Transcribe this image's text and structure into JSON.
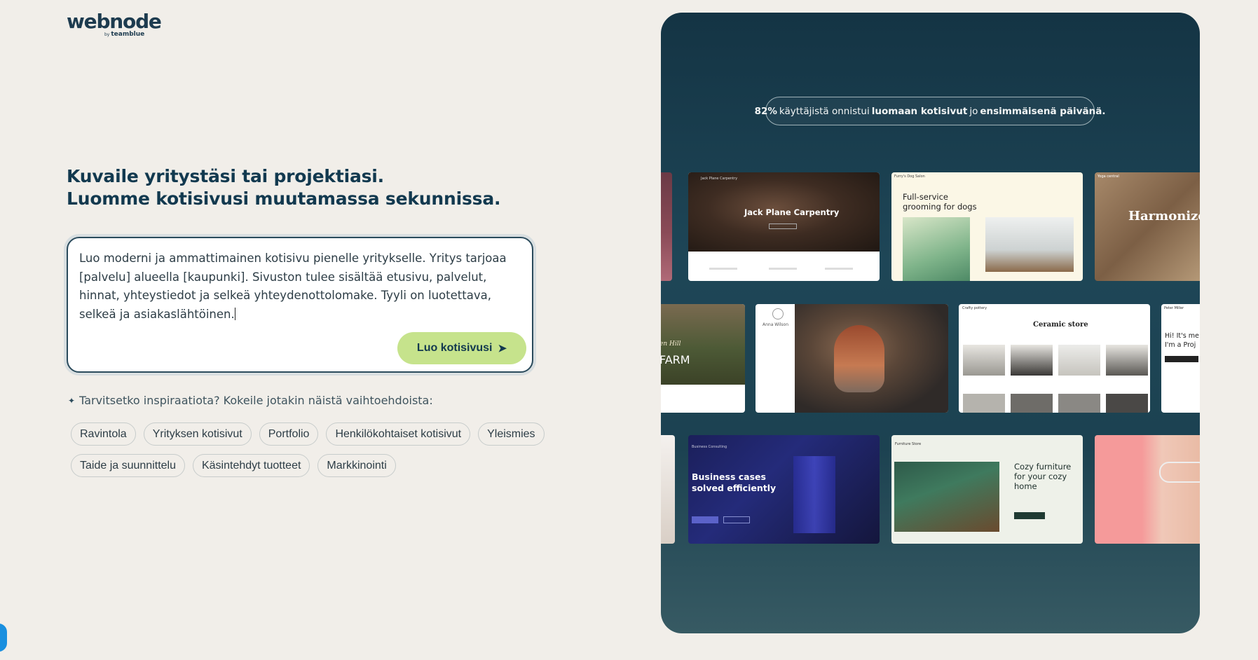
{
  "logo": {
    "word": "webnode",
    "by": "by",
    "brand": "teamblue"
  },
  "headline": {
    "line1": "Kuvaile yritystäsi tai projektiasi.",
    "line2": "Luomme kotisivusi muutamassa sekunnissa."
  },
  "prompt": {
    "text": "Luo moderni ja ammattimainen kotisivu pienelle yritykselle. Yritys tarjoaa [palvelu] alueella [kaupunki]. Sivuston tulee sisältää etusivu, palvelut, hinnat, yhteystiedot ja selkeä yhteydenottolomake. Tyyli on luotettava, selkeä ja asiakaslähtöinen.",
    "button": "Luo kotisivusi"
  },
  "inspiration": {
    "label": "Tarvitsetko inspiraatiota? Kokeile jotakin näistä vaihtoehdoista:",
    "chips_row1": [
      "Ravintola",
      "Yrityksen kotisivut",
      "Portfolio",
      "Henkilökohtaiset kotisivut",
      "Yleismies"
    ],
    "chips_row2": [
      "Taide ja suunnittelu",
      "Käsintehdyt tuotteet",
      "Markkinointi"
    ]
  },
  "panel": {
    "stat_percent": "82%",
    "stat_text1": "käyttäjistä onnistui",
    "stat_bold1": "luomaan kotisivut",
    "stat_text2": "jo",
    "stat_bold2": "ensimmäisenä päivänä.",
    "templates": {
      "carpentry": {
        "title": "Jack Plane Carpentry",
        "nav": "Jack Plane Carpentry"
      },
      "dogs": {
        "nav": "Furry's Dog Salon",
        "title1": "Full-service",
        "title2": "grooming for dogs"
      },
      "yoga": {
        "nav": "Yoga central",
        "title": "Harmonize"
      },
      "farm": {
        "title": "FARM",
        "sub": "en Hill"
      },
      "anna": {
        "name": "Anna Wilson"
      },
      "pottery": {
        "nav": "Crafty pottery",
        "title": "Ceramic store"
      },
      "peter": {
        "nav": "Peter Miller",
        "line1": "Hi! It's me",
        "line2": "I'm a Proj"
      },
      "business": {
        "nav": "Business Consulting",
        "title1": "Business cases",
        "title2": "solved efficiently"
      },
      "furniture": {
        "nav": "Furniture Store",
        "title1": "Cozy furniture",
        "title2": "for your cozy",
        "title3": "home"
      }
    }
  }
}
